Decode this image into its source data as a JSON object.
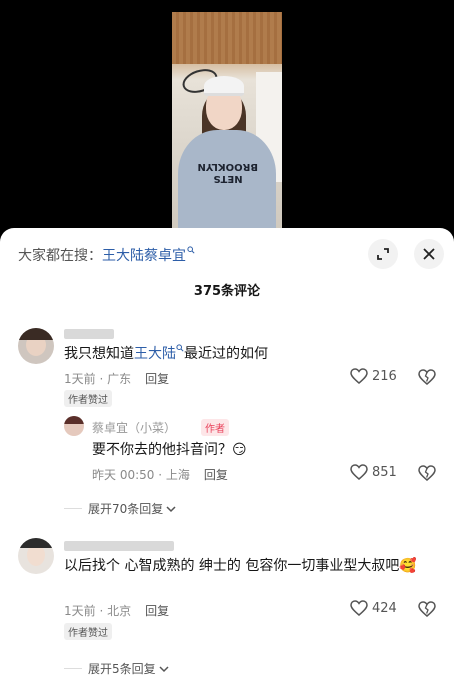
{
  "video": {
    "shirt_line1": "BROOKLYN",
    "shirt_line2": "NETS"
  },
  "search": {
    "prefix": "大家都在搜：",
    "term": "王大陆蔡卓宜"
  },
  "comment_count": "375条评论",
  "comments": [
    {
      "text_before": "我只想知道",
      "text_link": "王大陆",
      "text_after": "最近过的如何",
      "time": "1天前 · 广东",
      "reply_label": "回复",
      "liked_badge": "作者赞过",
      "likes": "216"
    },
    {
      "username": "蔡卓宜（小菜）",
      "author_tag": "作者",
      "text": "要不你去的他抖音问？",
      "emoji": "😏",
      "time": "昨天 00:50 · 上海",
      "reply_label": "回复",
      "likes": "851"
    },
    {
      "text": "以后找个 心智成熟的  绅士的  包容你一切事业型大叔吧",
      "emoji": "🥰",
      "time": "1天前 · 北京",
      "reply_label": "回复",
      "liked_badge": "作者赞过",
      "likes": "424"
    }
  ],
  "expand_replies": [
    {
      "label": "展开70条回复"
    },
    {
      "label": "展开5条回复"
    }
  ],
  "colors": {
    "link": "#2d5ea8",
    "author_tag": "#e9405a",
    "panel_bg": "#ffffff"
  }
}
